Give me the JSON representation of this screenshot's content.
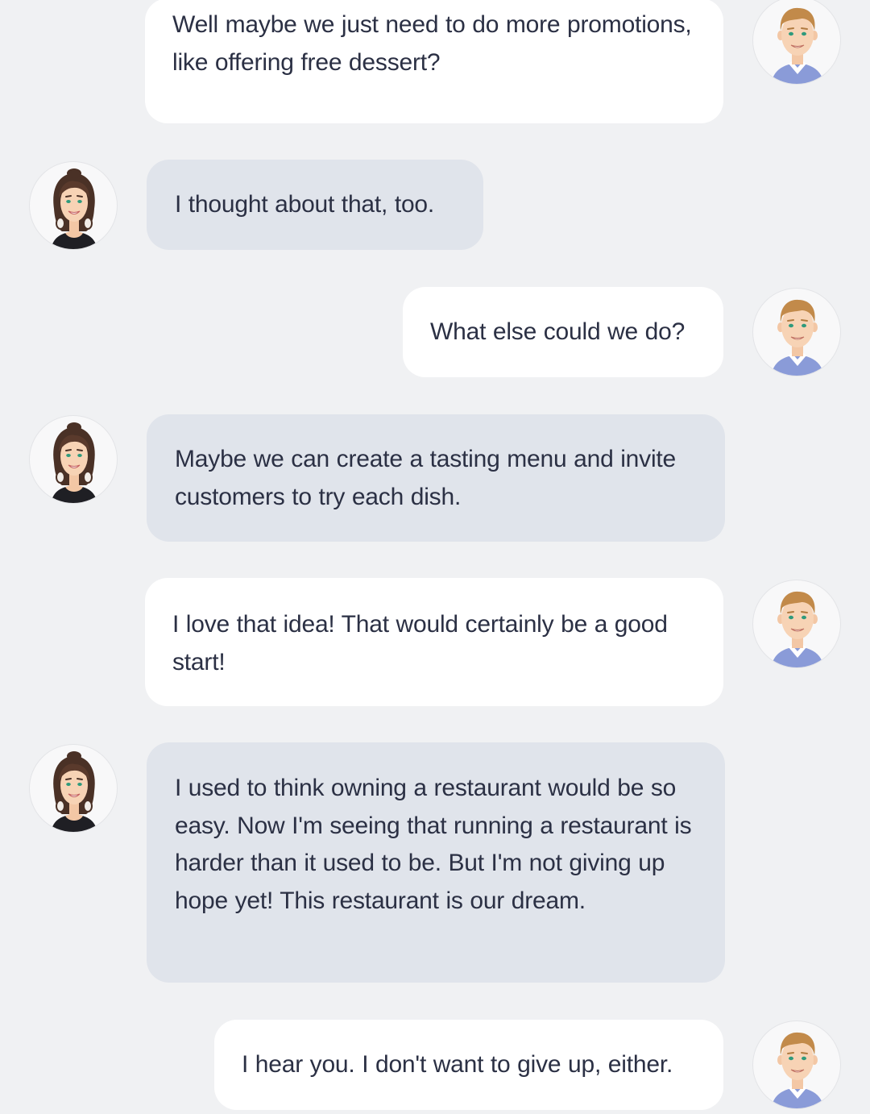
{
  "conversation": {
    "messages": [
      {
        "sender": "man",
        "text": "Well maybe we just need to do more promotions, like offering free dessert?"
      },
      {
        "sender": "woman",
        "text": "I thought about that, too."
      },
      {
        "sender": "man",
        "text": "What else could we do?"
      },
      {
        "sender": "woman",
        "text": "Maybe we can create a tasting menu and invite customers to try each dish."
      },
      {
        "sender": "man",
        "text": "I love that idea! That would certainly be a good start!"
      },
      {
        "sender": "woman",
        "text": "I used to think owning a restaurant would be so easy. Now I'm seeing that running a restaurant is harder than it used to be. But I'm not giving up hope yet! This restaurant is our dream."
      },
      {
        "sender": "man",
        "text": "I hear you. I don't want to give up, either."
      }
    ]
  },
  "colors": {
    "background": "#f0f1f3",
    "outgoing_bubble": "#ffffff",
    "incoming_bubble": "#e0e4eb",
    "text": "#2b3044"
  },
  "icons": {
    "man_avatar": "man-avatar-icon",
    "woman_avatar": "woman-avatar-icon"
  }
}
